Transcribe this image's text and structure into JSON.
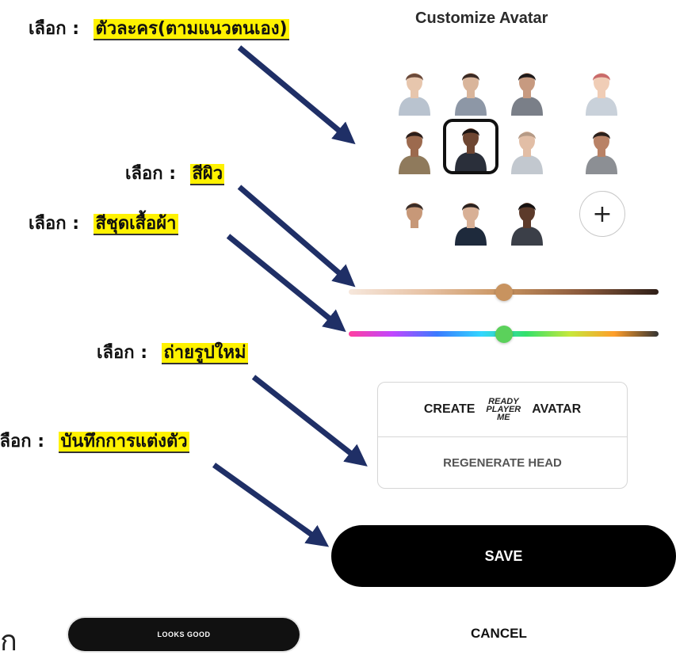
{
  "panel": {
    "title": "Customize Avatar",
    "add_icon_label": "+",
    "create_avatar": {
      "create_label": "CREATE",
      "logo_lines": [
        "READY",
        "PLAYER",
        "ME"
      ],
      "avatar_label": "AVATAR"
    },
    "regenerate_label": "REGENERATE HEAD",
    "save_label": "SAVE",
    "cancel_label": "CANCEL",
    "looks_good_label": "LOOKS GOOD",
    "selected_avatar_index": 5,
    "skin_tone_level": 0.5,
    "clothing_color_level": 0.5
  },
  "avatars": [
    {
      "name": "avatar-1",
      "skin": "#e7c6ad",
      "hair": "#6b4a3a",
      "top": "#b9c3cf"
    },
    {
      "name": "avatar-2",
      "skin": "#d9b59b",
      "hair": "#3a2a24",
      "top": "#8d97a6"
    },
    {
      "name": "avatar-3",
      "skin": "#c79a80",
      "hair": "#1f1a1a",
      "top": "#7a7f88"
    },
    {
      "name": "avatar-4",
      "skin": "#f0cdb6",
      "hair": "#c96a6a",
      "top": "#c9d1da"
    },
    {
      "name": "avatar-5",
      "skin": "#9c6a4e",
      "hair": "#2b1d19",
      "top": "#8f7a5c"
    },
    {
      "name": "avatar-6",
      "skin": "#6e4632",
      "hair": "#1b1412",
      "top": "#2a2f3a"
    },
    {
      "name": "avatar-7",
      "skin": "#e2bea6",
      "hair": "#b59a86",
      "top": "#c2c8cf"
    },
    {
      "name": "avatar-8",
      "skin": "#b98266",
      "hair": "#2a201c",
      "top": "#8c8f94"
    },
    {
      "name": "avatar-9",
      "skin": "#c79878",
      "hair": "#3a2c26",
      "top": "#ffffff"
    },
    {
      "name": "avatar-10",
      "skin": "#d8b096",
      "hair": "#2b2220",
      "top": "#1e2a3c"
    },
    {
      "name": "avatar-11",
      "skin": "#5c3a2a",
      "hair": "#161212",
      "top": "#3b3f48"
    }
  ],
  "annotations": [
    {
      "prefix": "เลือก :",
      "text": "ตัวละคร(ตามแนวตนเอง)"
    },
    {
      "prefix": "เลือก :",
      "text": "สีผิว"
    },
    {
      "prefix": "เลือก :",
      "text": "สีชุดเสื้อผ้า"
    },
    {
      "prefix": "เลือก :",
      "text": "ถ่ายรูปใหม่"
    },
    {
      "prefix": "เลือก :",
      "text": "บันทึกการแต่งตัว"
    }
  ],
  "stray_glyph": "ก",
  "colors": {
    "arrow": "#1f2f66",
    "highlight": "#fff200",
    "skin_gradient": [
      "#f6e7dc",
      "#e7c2a4",
      "#c8935f",
      "#8b5a3c",
      "#2e1e17"
    ],
    "skin_thumb": "#c8935f",
    "clothing_gradient": [
      "#ff3fa0",
      "#c046ff",
      "#3a7bff",
      "#33d6ff",
      "#33e06b",
      "#c7e83b",
      "#ff9e2b",
      "#333333"
    ],
    "clothing_thumb": "#5bd15b"
  }
}
